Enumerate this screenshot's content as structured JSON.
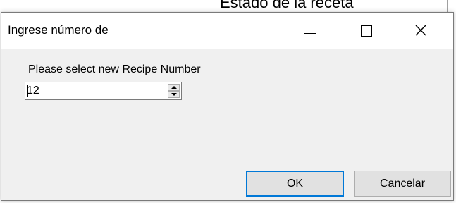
{
  "background": {
    "partial_title": "Estado de la receta"
  },
  "dialog": {
    "title": "Ingrese número de",
    "prompt": "Please select new Recipe Number",
    "recipe_number": "12",
    "ok_label": "OK",
    "cancel_label": "Cancelar"
  },
  "icons": {
    "minimize": "minimize-icon",
    "maximize": "maximize-icon",
    "close": "close-icon",
    "spin_up": "chevron-up-icon",
    "spin_down": "chevron-down-icon"
  },
  "colors": {
    "dialog_bg": "#f0f0f0",
    "titlebar_bg": "#ffffff",
    "default_button_border": "#0078d7",
    "button_bg": "#e1e1e1"
  }
}
